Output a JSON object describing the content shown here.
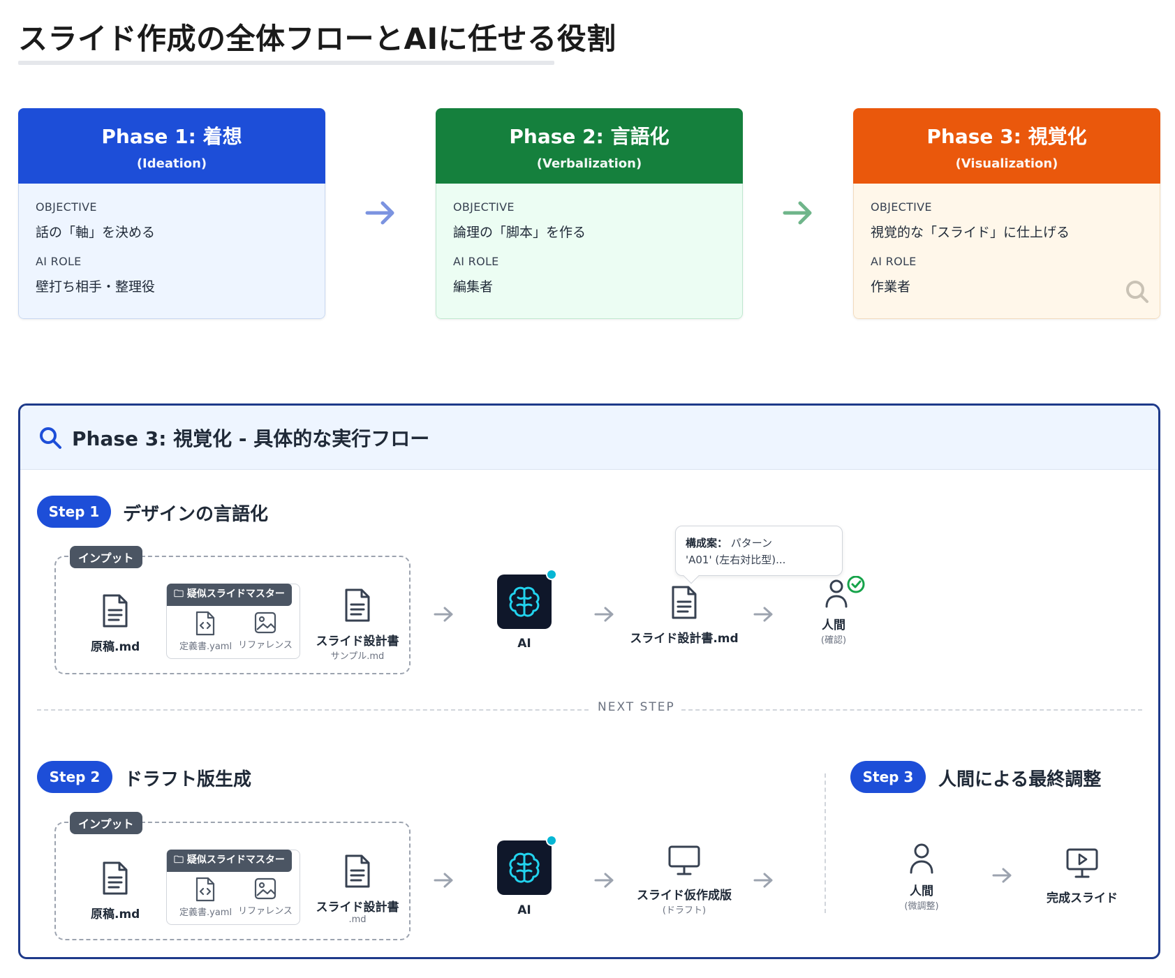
{
  "page": {
    "title": "スライド作成の全体フローとAIに任せる役割"
  },
  "labels": {
    "objective": "OBJECTIVE",
    "ai_role": "AI ROLE"
  },
  "phases": [
    {
      "title": "Phase 1: 着想",
      "subtitle": "(Ideation)",
      "objective": "話の「軸」を決める",
      "ai_role": "壁打ち相手・整理役",
      "color": "#1d4ed8"
    },
    {
      "title": "Phase 2: 言語化",
      "subtitle": "(Verbalization)",
      "objective": "論理の「脚本」を作る",
      "ai_role": "編集者",
      "color": "#15803d"
    },
    {
      "title": "Phase 3: 視覚化",
      "subtitle": "(Visualization)",
      "objective": "視覚的な「スライド」に仕上げる",
      "ai_role": "作業者",
      "color": "#ea580c"
    }
  ],
  "flow": {
    "title": "Phase 3: 視覚化 - 具体的な実行フロー",
    "input_tag": "インプット",
    "master_tag": "疑似スライドマスター",
    "next_step": "NEXT STEP",
    "step1": {
      "pill": "Step 1",
      "title": "デザインの言語化",
      "manuscript": "原稿.md",
      "definition": "定義書.yaml",
      "reference": "リファレンス",
      "design_doc": "スライド設計書",
      "design_doc_sub": "サンプル.md",
      "ai": "AI",
      "output": "スライド設計書.md",
      "tooltip_label": "構成案：",
      "tooltip_text_1": "パターン",
      "tooltip_text_2": "'A01' (左右対比型)...",
      "human": "人間",
      "human_sub": "(確認)"
    },
    "step2": {
      "pill": "Step 2",
      "title": "ドラフト版生成",
      "manuscript": "原稿.md",
      "definition": "定義書.yaml",
      "reference": "リファレンス",
      "design_doc": "スライド設計書",
      "design_doc_sub": ".md",
      "ai": "AI",
      "output": "スライド仮作成版",
      "output_sub": "(ドラフト)"
    },
    "step3": {
      "pill": "Step 3",
      "title": "人間による最終調整",
      "human": "人間",
      "human_sub": "(微調整)",
      "final": "完成スライド"
    }
  },
  "colors": {
    "primary": "#1d4ed8",
    "green": "#15803d",
    "orange": "#ea580c",
    "ai_dot": "#06b6d4",
    "check": "#16a34a"
  }
}
